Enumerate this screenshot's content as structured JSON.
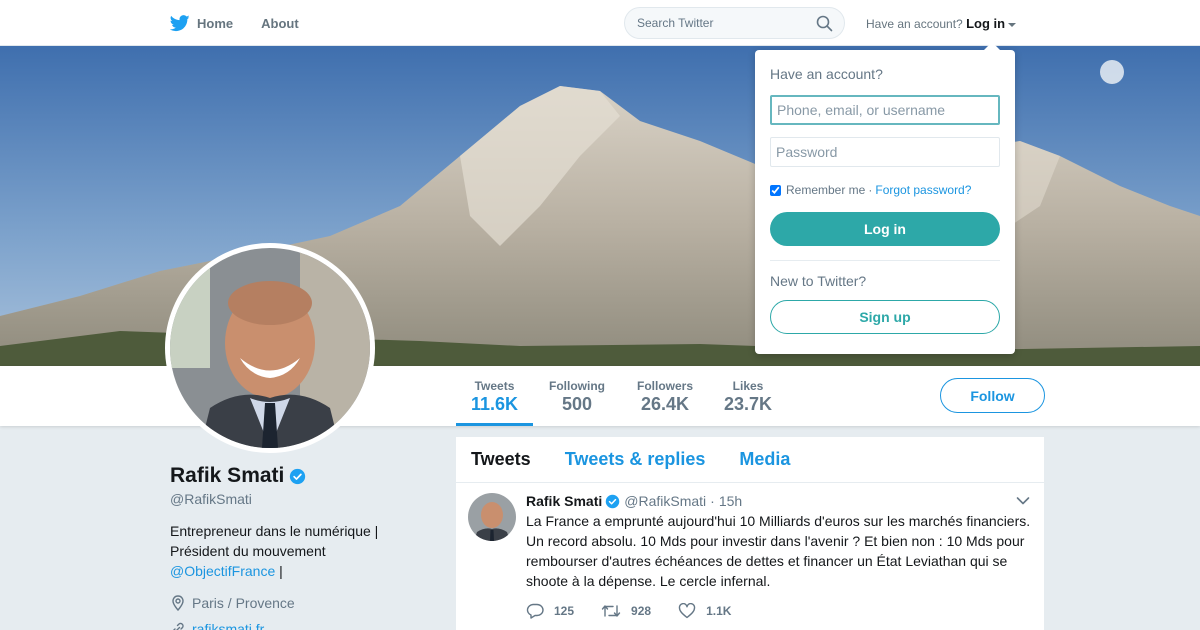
{
  "nav": {
    "home": "Home",
    "about": "About",
    "search_placeholder": "Search Twitter",
    "account_prompt": "Have an account?",
    "login": "Log in"
  },
  "stats": [
    {
      "label": "Tweets",
      "value": "11.6K"
    },
    {
      "label": "Following",
      "value": "500"
    },
    {
      "label": "Followers",
      "value": "26.4K"
    },
    {
      "label": "Likes",
      "value": "23.7K"
    }
  ],
  "follow_label": "Follow",
  "profile": {
    "name": "Rafik Smati",
    "handle": "@RafikSmati",
    "bio_line1": "Entrepreneur dans le numérique |",
    "bio_line2": "Président du mouvement",
    "bio_mention": "@ObjectifFrance",
    "bio_tail": " |",
    "location": "Paris / Provence",
    "url": "rafiksmati.fr"
  },
  "timeline": {
    "tabs": [
      "Tweets",
      "Tweets & replies",
      "Media"
    ],
    "tweet": {
      "name": "Rafik Smati",
      "handle": "@RafikSmati",
      "sep": "·",
      "time": "15h",
      "text": "La France a emprunté aujourd'hui 10 Milliards d'euros sur les marchés financiers. Un record absolu. 10 Mds pour investir dans l'avenir ? Et bien non : 10 Mds pour rembourser d'autres échéances de dettes et financer un État Leviathan qui se shoote à la dépense. Le cercle infernal.",
      "replies": "125",
      "retweets": "928",
      "likes": "1.1K"
    }
  },
  "login_dropdown": {
    "title": "Have an account?",
    "user_placeholder": "Phone, email, or username",
    "password_placeholder": "Password",
    "remember": "Remember me",
    "dot": "·",
    "forgot": "Forgot password?",
    "login_button": "Log in",
    "new_prompt": "New to Twitter?",
    "signup_button": "Sign up"
  },
  "colors": {
    "brand_blue": "#1b95e0",
    "teal": "#2da8a8",
    "bg": "#e6ecf0"
  }
}
